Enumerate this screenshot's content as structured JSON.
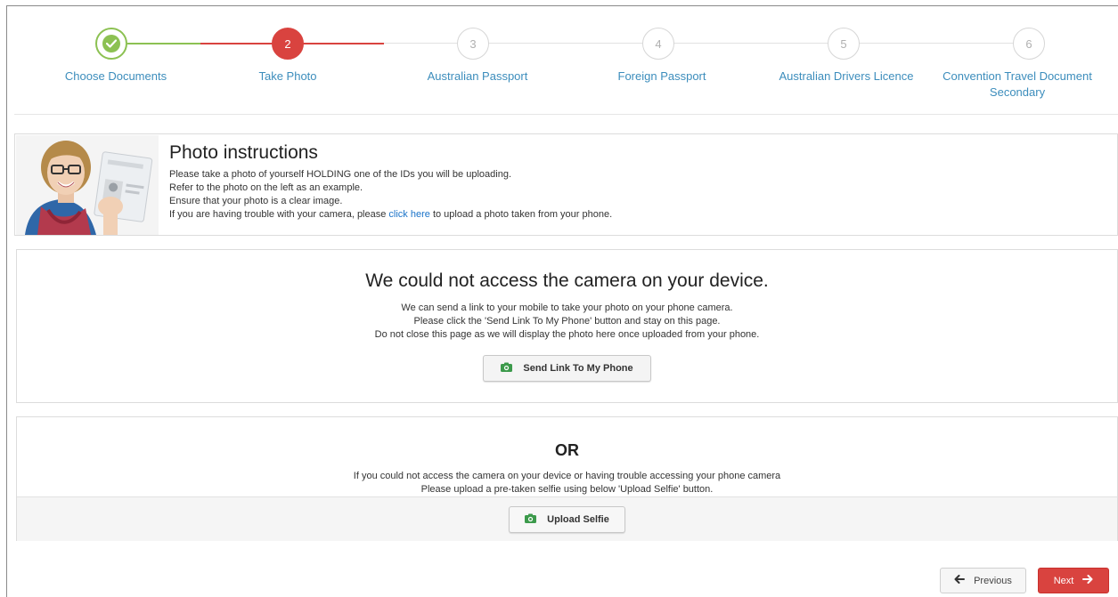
{
  "colors": {
    "done": "#8cc152",
    "active": "#d9433f",
    "pending": "#d6d6d6",
    "link": "#3c8dbc",
    "camera_icon": "#3c9a4b"
  },
  "steps": [
    {
      "number": "",
      "label": "Choose Documents",
      "status": "done",
      "icon": "check-icon"
    },
    {
      "number": "2",
      "label": "Take Photo",
      "status": "active"
    },
    {
      "number": "3",
      "label": "Australian Passport",
      "status": "pending"
    },
    {
      "number": "4",
      "label": "Foreign Passport",
      "status": "pending"
    },
    {
      "number": "5",
      "label": "Australian Drivers Licence",
      "status": "pending"
    },
    {
      "number": "6",
      "label": "Convention Travel Document Secondary",
      "status": "pending"
    }
  ],
  "instructions": {
    "title": "Photo instructions",
    "line1": "Please take a photo of yourself HOLDING one of the IDs you will be uploading.",
    "line2": "Refer to the photo on the left as an example.",
    "line3": "Ensure that your photo is a clear image.",
    "line4_prefix": "If you are having trouble with your camera, please ",
    "line4_link": "click here",
    "line4_suffix": " to upload a photo taken from your phone."
  },
  "camera": {
    "title": "We could not access the camera on your device.",
    "line1": "We can send a link to your mobile to take your photo on your phone camera.",
    "line2": "Please click the 'Send Link To My Phone' button and stay on this page.",
    "line3": "Do not close this page as we will display the photo here once uploaded from your phone.",
    "send_button": "Send Link To My Phone",
    "send_icon": "camera-icon"
  },
  "alternative": {
    "title": "OR",
    "line1": "If you could not access the camera on your device or having trouble accessing your phone camera",
    "line2": "Please upload a pre-taken selfie using below 'Upload Selfie' button.",
    "upload_button": "Upload Selfie",
    "upload_icon": "camera-icon"
  },
  "nav": {
    "previous_label": "Previous",
    "previous_icon": "arrow-left-icon",
    "next_label": "Next",
    "next_icon": "arrow-right-icon"
  }
}
